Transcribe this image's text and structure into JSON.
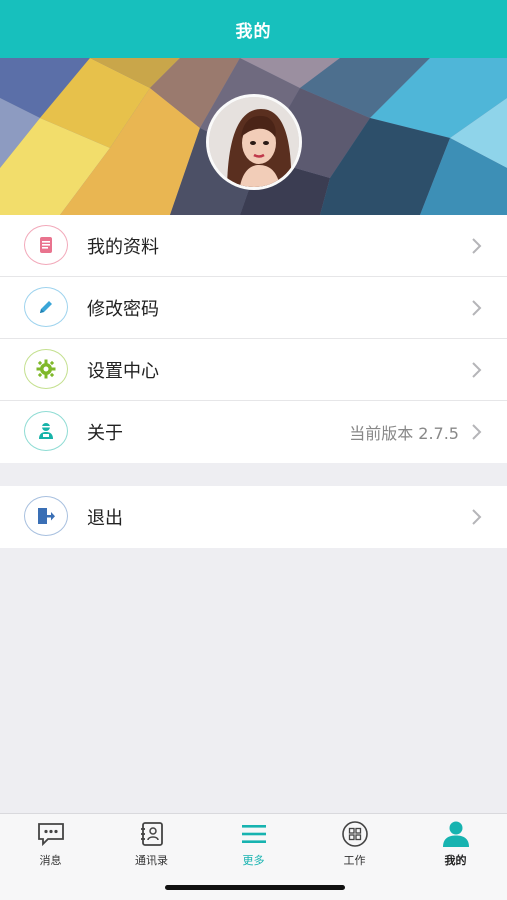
{
  "header": {
    "title": "我的"
  },
  "menu": {
    "items": [
      {
        "label": "我的资料",
        "icon": "profile-doc-icon",
        "color": "#e9738e"
      },
      {
        "label": "修改密码",
        "icon": "pencil-icon",
        "color": "#3aa6d8"
      },
      {
        "label": "设置中心",
        "icon": "gear-icon",
        "color": "#7fb82a"
      },
      {
        "label": "关于",
        "value": "当前版本 2.7.5",
        "icon": "about-person-icon",
        "color": "#17b3a8"
      }
    ],
    "logout": {
      "label": "退出",
      "icon": "logout-door-icon",
      "color": "#3a6fb5"
    }
  },
  "tabbar": {
    "tabs": [
      {
        "label": "消息",
        "icon": "chat-bubble-icon"
      },
      {
        "label": "通讯录",
        "icon": "contacts-book-icon"
      },
      {
        "label": "更多",
        "icon": "menu-lines-icon",
        "active": true
      },
      {
        "label": "工作",
        "icon": "grid-circle-icon"
      },
      {
        "label": "我的",
        "icon": "person-icon",
        "selected": true
      }
    ]
  },
  "colors": {
    "accent": "#17c0bd",
    "background": "#eeeef2"
  }
}
